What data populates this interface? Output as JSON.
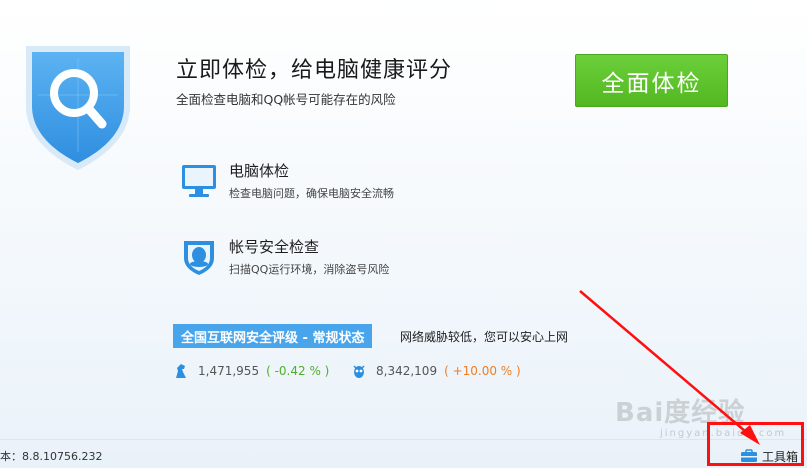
{
  "hero": {
    "title": "立即体检，给电脑健康评分",
    "subtitle": "全面检查电脑和QQ帐号可能存在的风险",
    "scan_button": "全面体检"
  },
  "features": [
    {
      "icon": "monitor-icon",
      "title": "电脑体检",
      "desc": "检查电脑问题，确保电脑安全流畅"
    },
    {
      "icon": "qq-penguin-shield-icon",
      "title": "帐号安全检查",
      "desc": "扫描QQ运行环境，消除盗号风险"
    }
  ],
  "security": {
    "badge": "全国互联网安全评级 - 常规状态",
    "note": "网络威胁较低，您可以安心上网"
  },
  "stats": [
    {
      "icon": "horse-icon",
      "value": "1,471,955",
      "change": "( -0.42 % )",
      "change_color": "#4fae2a"
    },
    {
      "icon": "virus-bug-icon",
      "value": "8,342,109",
      "change": "( +10.00 % )",
      "change_color": "#ee7d25"
    }
  ],
  "footer": {
    "version": "本：8.8.10756.232",
    "toolbox": "工具箱"
  },
  "watermark": {
    "text": "Bai度经验",
    "sub": "jingyan.baidu.com"
  },
  "colors": {
    "accent_green": "#52b821",
    "accent_blue": "#48a5ec",
    "annotation_red": "#ff1010"
  }
}
